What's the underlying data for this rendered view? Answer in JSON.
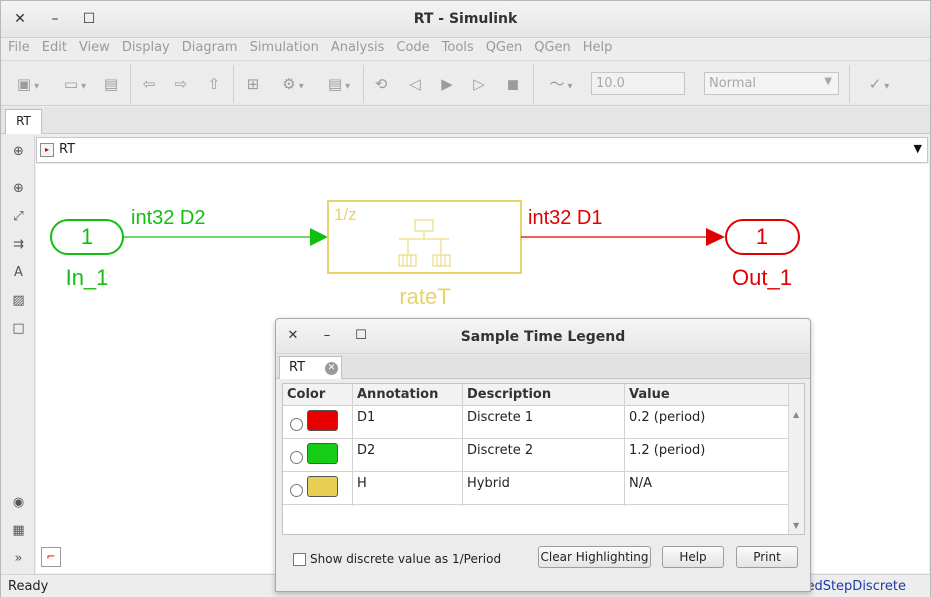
{
  "window": {
    "title": "RT - Simulink"
  },
  "menu": [
    "File",
    "Edit",
    "View",
    "Display",
    "Diagram",
    "Simulation",
    "Analysis",
    "Code",
    "Tools",
    "QGen",
    "QGen",
    "Help"
  ],
  "toolbar": {
    "stop_time": "10.0",
    "sim_mode": "Normal"
  },
  "tabs": {
    "main": "RT"
  },
  "address": {
    "path": "RT"
  },
  "diagram": {
    "in_port": {
      "number": "1",
      "name": "In_1"
    },
    "out_port": {
      "number": "1",
      "name": "Out_1"
    },
    "rate_block": {
      "label": "1/z",
      "name": "rateT"
    },
    "signal_in": "int32 D2",
    "signal_out": "int32 D1",
    "colors": {
      "d1": "#e00000",
      "d2": "#10c010",
      "hybrid": "#e6d36a"
    }
  },
  "status": {
    "ready": "Ready",
    "solver": "edStepDiscrete"
  },
  "legend": {
    "title": "Sample Time Legend",
    "tab": "RT",
    "columns": [
      "Color",
      "Annotation",
      "Description",
      "Value"
    ],
    "rows": [
      {
        "color": "#e60000",
        "annotation": "D1",
        "description": "Discrete 1",
        "value": "0.2 (period)"
      },
      {
        "color": "#16cc16",
        "annotation": "D2",
        "description": "Discrete 2",
        "value": "1.2 (period)"
      },
      {
        "color": "#e7cf54",
        "annotation": "H",
        "description": "Hybrid",
        "value": "N/A"
      }
    ],
    "checkbox_label": "Show discrete value as 1/Period",
    "buttons": {
      "clear": "Clear Highlighting",
      "help": "Help",
      "print": "Print"
    }
  }
}
